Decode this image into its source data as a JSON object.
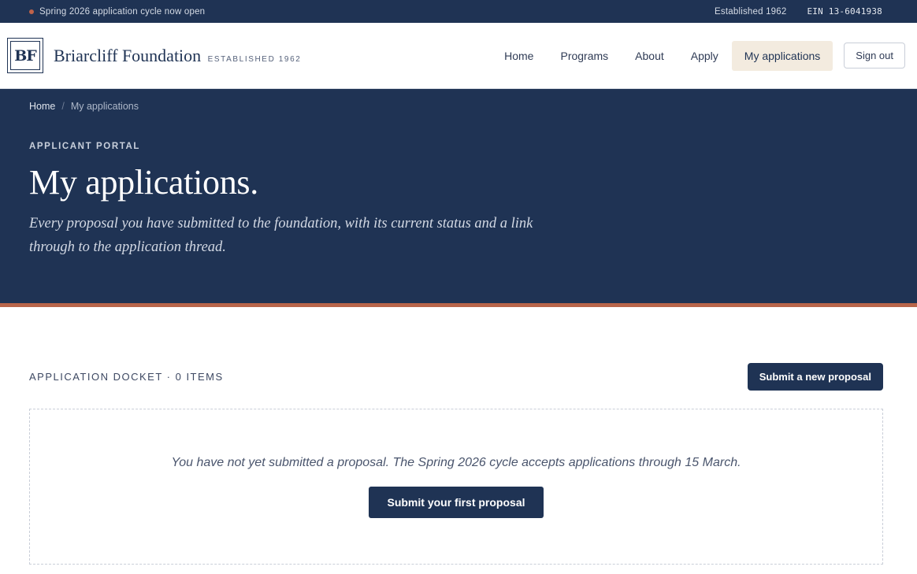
{
  "topstrip": {
    "announcement": "Spring 2026 application cycle now open",
    "established": "Established 1962",
    "ein": "EIN 13-6041938"
  },
  "brand": {
    "monogram": "BF",
    "name": "Briarcliff Foundation",
    "tagline": "ESTABLISHED 1962"
  },
  "nav": {
    "items": [
      {
        "label": "Home"
      },
      {
        "label": "Programs"
      },
      {
        "label": "About"
      },
      {
        "label": "Apply"
      },
      {
        "label": "My applications"
      }
    ],
    "sign_out": "Sign out"
  },
  "breadcrumb": {
    "home": "Home",
    "separator": "/",
    "current": "My applications"
  },
  "hero": {
    "eyebrow": "APPLICANT PORTAL",
    "title": "My applications.",
    "subtitle": "Every proposal you have submitted to the foundation, with its current status and a link through to the application thread."
  },
  "docket": {
    "title": "APPLICATION DOCKET · 0 ITEMS",
    "submit_new": "Submit a new proposal",
    "empty_message": "You have not yet submitted a proposal. The Spring 2026 cycle accepts applications through 15 March.",
    "submit_first": "Submit your first proposal"
  },
  "colors": {
    "navy": "#1f3354",
    "accent": "#b8654a",
    "active_nav_bg": "#f3ebdf"
  }
}
